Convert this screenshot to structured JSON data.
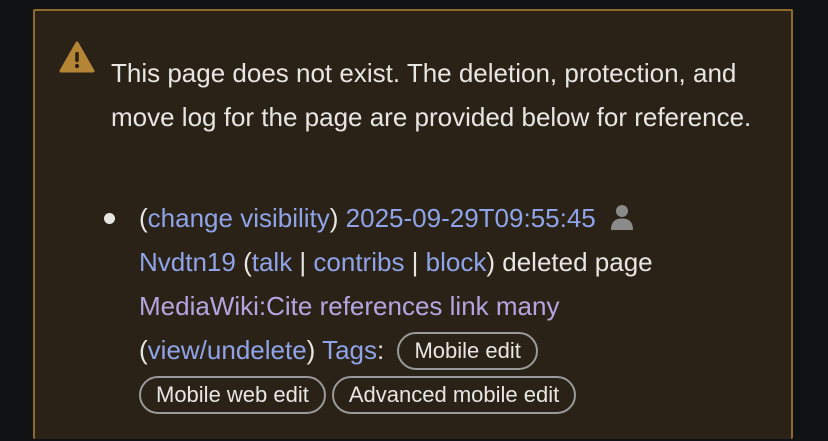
{
  "notice": {
    "icon": "warning-triangle-icon",
    "message": "This page does not exist. The deletion, protection, and move log for the page are provided below for reference."
  },
  "log_entry": {
    "open_paren": "(",
    "change_visibility": "change visibility",
    "close_paren": ")",
    "timestamp": "2025-09-29T09:55:45",
    "user_icon": "user-icon",
    "user": "Nvdtn19",
    "talk": "talk",
    "contribs": "contribs",
    "block": "block",
    "action": "deleted page",
    "page": "MediaWiki:Cite references link many",
    "view_undelete": "view/undelete",
    "tags_label": "Tags",
    "tags": [
      "Mobile edit",
      "Mobile web edit",
      "Advanced mobile edit"
    ]
  },
  "colors": {
    "link": "#8fa4e8",
    "visited_link": "#b3a6e0",
    "notice_bg": "#2b2217",
    "notice_border": "#8d6a2e",
    "warning_icon": "#b58536"
  }
}
